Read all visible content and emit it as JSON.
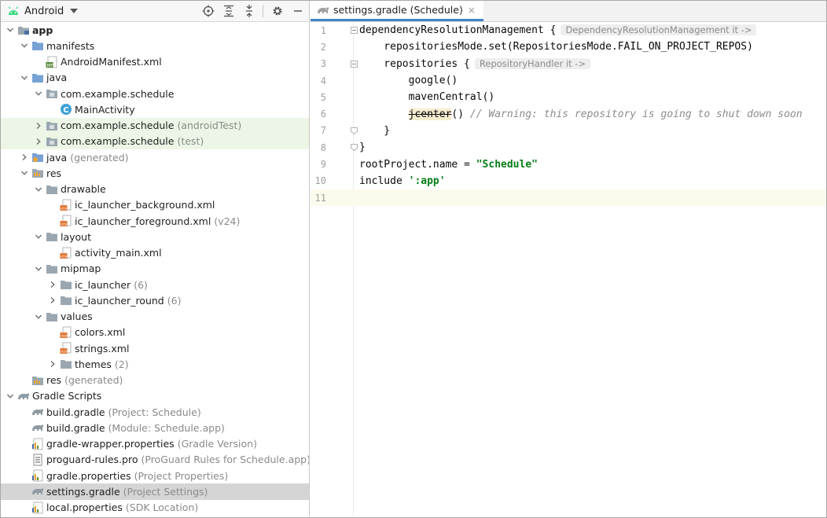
{
  "project_panel": {
    "view_selector": "Android",
    "toolbar_icons": [
      "locate-icon",
      "expand-all-icon",
      "collapse-all-icon",
      "gear-icon",
      "minimize-icon"
    ],
    "tree": [
      {
        "label": "app",
        "hint": ""
      },
      {
        "label": "manifests",
        "hint": ""
      },
      {
        "label": "AndroidManifest.xml",
        "hint": ""
      },
      {
        "label": "java",
        "hint": ""
      },
      {
        "label": "com.example.schedule",
        "hint": ""
      },
      {
        "label": "MainActivity",
        "hint": ""
      },
      {
        "label": "com.example.schedule",
        "hint": "(androidTest)"
      },
      {
        "label": "com.example.schedule",
        "hint": "(test)"
      },
      {
        "label": "java",
        "hint": "(generated)"
      },
      {
        "label": "res",
        "hint": ""
      },
      {
        "label": "drawable",
        "hint": ""
      },
      {
        "label": "ic_launcher_background.xml",
        "hint": ""
      },
      {
        "label": "ic_launcher_foreground.xml",
        "hint": "(v24)"
      },
      {
        "label": "layout",
        "hint": ""
      },
      {
        "label": "activity_main.xml",
        "hint": ""
      },
      {
        "label": "mipmap",
        "hint": ""
      },
      {
        "label": "ic_launcher",
        "hint": "(6)"
      },
      {
        "label": "ic_launcher_round",
        "hint": "(6)"
      },
      {
        "label": "values",
        "hint": ""
      },
      {
        "label": "colors.xml",
        "hint": ""
      },
      {
        "label": "strings.xml",
        "hint": ""
      },
      {
        "label": "themes",
        "hint": "(2)"
      },
      {
        "label": "res",
        "hint": "(generated)"
      },
      {
        "label": "Gradle Scripts",
        "hint": ""
      },
      {
        "label": "build.gradle",
        "hint": "(Project: Schedule)"
      },
      {
        "label": "build.gradle",
        "hint": "(Module: Schedule.app)"
      },
      {
        "label": "gradle-wrapper.properties",
        "hint": "(Gradle Version)"
      },
      {
        "label": "proguard-rules.pro",
        "hint": "(ProGuard Rules for Schedule.app)"
      },
      {
        "label": "gradle.properties",
        "hint": "(Project Properties)"
      },
      {
        "label": "settings.gradle",
        "hint": "(Project Settings)"
      },
      {
        "label": "local.properties",
        "hint": "(SDK Location)"
      }
    ]
  },
  "editor": {
    "tab": {
      "label": "settings.gradle (Schedule)",
      "close": "×"
    },
    "lines": [
      {
        "num": "1",
        "text": "dependencyResolutionManagement {",
        "inlay": "DependencyResolutionManagement it ->"
      },
      {
        "num": "2",
        "text": "    repositoriesMode.set(RepositoriesMode.FAIL_ON_PROJECT_REPOS)",
        "inlay": ""
      },
      {
        "num": "3",
        "text": "    repositories {",
        "inlay": "RepositoryHandler it ->"
      },
      {
        "num": "4",
        "text": "        google()",
        "inlay": ""
      },
      {
        "num": "5",
        "text": "        mavenCentral()",
        "inlay": ""
      },
      {
        "num": "6",
        "pre": "        ",
        "struck": "jcenter",
        "post": "()",
        "comment": " // Warning: this repository is going to shut down soon"
      },
      {
        "num": "7",
        "text": "    }",
        "inlay": ""
      },
      {
        "num": "8",
        "text": "}",
        "inlay": ""
      },
      {
        "num": "9",
        "pre": "rootProject.name = ",
        "str": "\"Schedule\""
      },
      {
        "num": "10",
        "pre": "include ",
        "str": "':app'"
      },
      {
        "num": "11",
        "text": "",
        "inlay": ""
      }
    ]
  },
  "colors": {
    "accent_tab": "#4083c9",
    "test_bg": "#edf6e6",
    "selected_bg": "#d5d5d5",
    "string": "#067d17"
  }
}
